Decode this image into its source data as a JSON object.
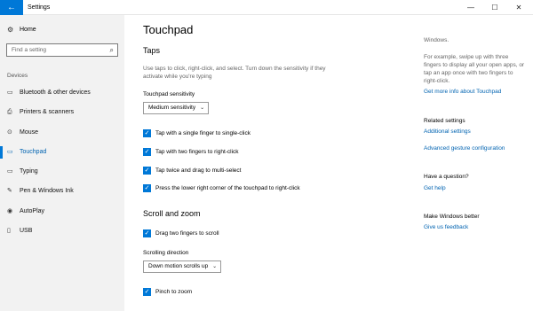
{
  "window": {
    "title": "Settings",
    "back_glyph": "←",
    "minimize_glyph": "—",
    "maximize_glyph": "☐",
    "close_glyph": "✕"
  },
  "sidebar": {
    "home_label": "Home",
    "home_icon": "gear-icon",
    "search_placeholder": "Find a setting",
    "category": "Devices",
    "items": [
      {
        "label": "Bluetooth & other devices",
        "icon": "bluetooth-icon",
        "glyph": "▭"
      },
      {
        "label": "Printers & scanners",
        "icon": "printer-icon",
        "glyph": "⎙"
      },
      {
        "label": "Mouse",
        "icon": "mouse-icon",
        "glyph": "⊙"
      },
      {
        "label": "Touchpad",
        "icon": "touchpad-icon",
        "glyph": "▭",
        "active": true
      },
      {
        "label": "Typing",
        "icon": "keyboard-icon",
        "glyph": "▭"
      },
      {
        "label": "Pen & Windows Ink",
        "icon": "pen-icon",
        "glyph": "✎"
      },
      {
        "label": "AutoPlay",
        "icon": "autoplay-icon",
        "glyph": "◉"
      },
      {
        "label": "USB",
        "icon": "usb-icon",
        "glyph": "▯"
      }
    ]
  },
  "main": {
    "title": "Touchpad",
    "taps": {
      "heading": "Taps",
      "description": "Use taps to click, right-click, and select. Turn down the sensitivity if they activate while you're typing",
      "sensitivity_label": "Touchpad sensitivity",
      "sensitivity_value": "Medium sensitivity",
      "options": [
        {
          "label": "Tap with a single finger to single-click",
          "checked": true
        },
        {
          "label": "Tap with two fingers to right-click",
          "checked": true
        },
        {
          "label": "Tap twice and drag to multi-select",
          "checked": true
        },
        {
          "label": "Press the lower right corner of the touchpad to right-click",
          "checked": true
        }
      ]
    },
    "scroll": {
      "heading": "Scroll and zoom",
      "drag_label": "Drag two fingers to scroll",
      "direction_label": "Scrolling direction",
      "direction_value": "Down motion scrolls up",
      "pinch_label": "Pinch to zoom"
    }
  },
  "right_panel": {
    "intro_tail": "Windows.",
    "example": "For example, swipe up with three fingers to display all your open apps, or tap an app once with two fingers to right-click.",
    "more_info_link": "Get more info about Touchpad",
    "related_heading": "Related settings",
    "additional_link": "Additional settings",
    "gesture_link": "Advanced gesture configuration",
    "question_heading": "Have a question?",
    "help_link": "Get help",
    "better_heading": "Make Windows better",
    "feedback_link": "Give us feedback"
  },
  "colors": {
    "accent": "#0078d7",
    "link": "#0063b1",
    "sidebar_bg": "#f2f2f2"
  }
}
